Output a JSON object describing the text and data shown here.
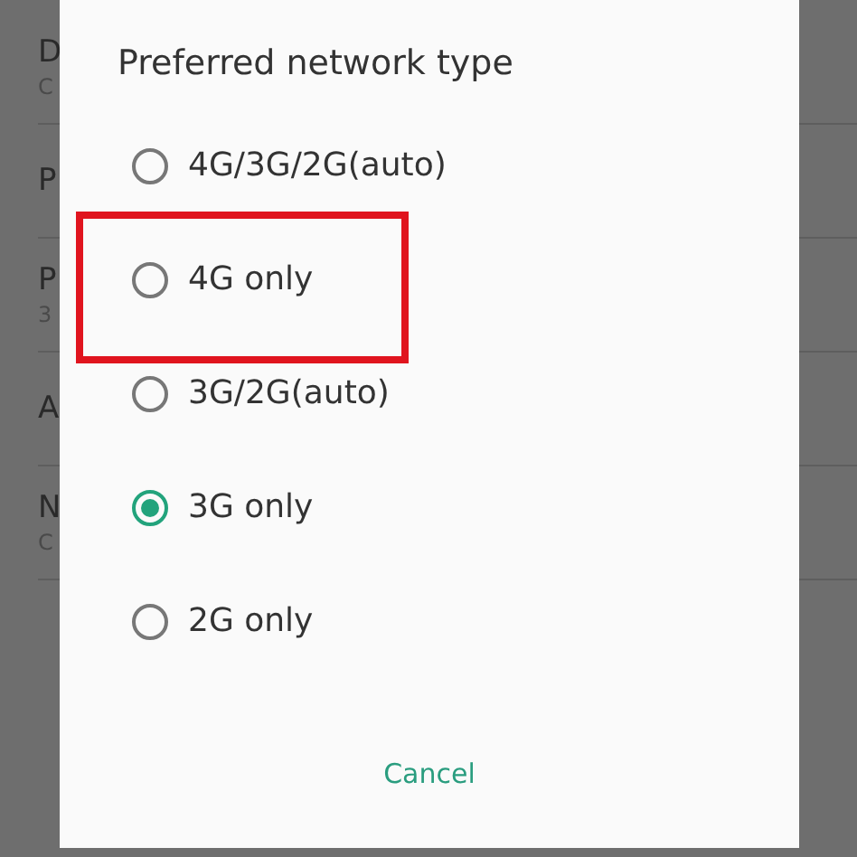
{
  "background_list": [
    {
      "title": "D",
      "subtitle": "C"
    },
    {
      "title": "P"
    },
    {
      "title": "P",
      "subtitle": "3"
    },
    {
      "title": "A"
    },
    {
      "title": "N",
      "subtitle": "C"
    }
  ],
  "dialog": {
    "title": "Preferred network type",
    "options": [
      {
        "label": "4G/3G/2G(auto)",
        "selected": false,
        "highlighted": false
      },
      {
        "label": "4G only",
        "selected": false,
        "highlighted": true
      },
      {
        "label": "3G/2G(auto)",
        "selected": false,
        "highlighted": false
      },
      {
        "label": "3G only",
        "selected": true,
        "highlighted": false
      },
      {
        "label": "2G only",
        "selected": false,
        "highlighted": false
      }
    ],
    "cancel": "Cancel"
  }
}
